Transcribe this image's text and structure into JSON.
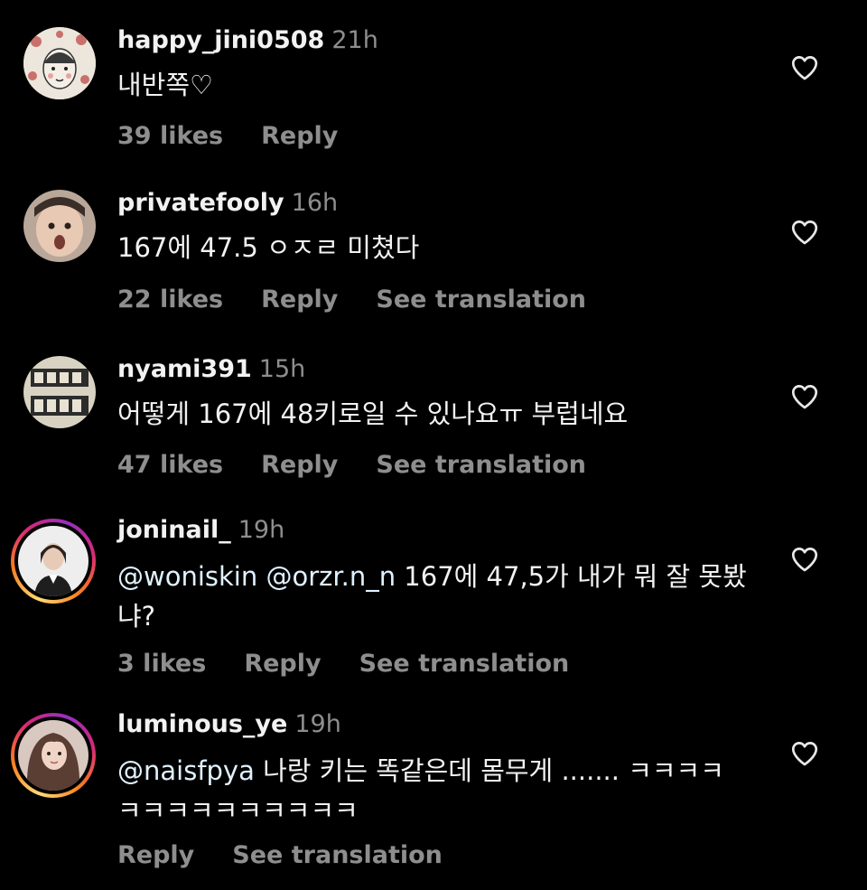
{
  "comments": [
    {
      "username": "happy_jini0508",
      "time": "21h",
      "text": "내반쪽♡",
      "likes": "39 likes",
      "reply": "Reply",
      "translate": ""
    },
    {
      "username": "privatefooly",
      "time": "16h",
      "text": "167에 47.5 ㅇㅈㄹ 미쳤다",
      "likes": "22 likes",
      "reply": "Reply",
      "translate": "See translation"
    },
    {
      "username": "nyami391",
      "time": "15h",
      "text": "어떻게 167에 48키로일 수 있나요ㅠ 부럽네요",
      "likes": "47 likes",
      "reply": "Reply",
      "translate": "See translation"
    },
    {
      "username": "joninail_",
      "time": "19h",
      "mention": "@woniskin @orzr.n_n",
      "text": " 167에 47,5가 내가 뭐 잘 못봤냐?",
      "likes": "3 likes",
      "reply": "Reply",
      "translate": "See translation"
    },
    {
      "username": "luminous_ye",
      "time": "19h",
      "mention": "@naisfpya",
      "text": " 나랑 키는 똑같은데 몸무게 ....... ㅋㅋㅋㅋㅋㅋㅋㅋㅋㅋㅋㅋㅋㅋ",
      "likes": "",
      "reply": "Reply",
      "translate": "See translation"
    }
  ],
  "icons": {
    "like": "heart-outline-icon"
  },
  "colors": {
    "background": "#000000",
    "primary_text": "#f2f2f2",
    "secondary_text": "#8e8e8e",
    "mention": "#e0f1ff"
  }
}
